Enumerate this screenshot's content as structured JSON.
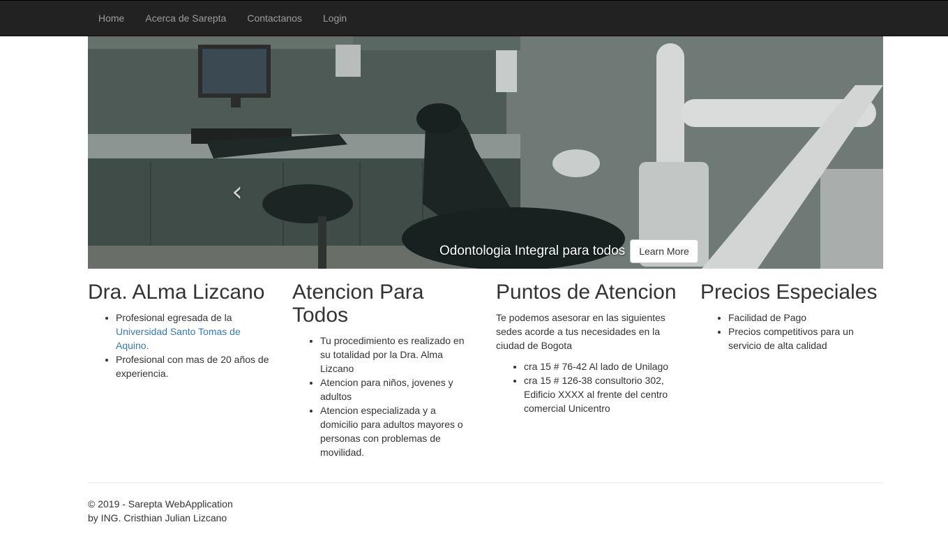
{
  "nav": {
    "items": [
      {
        "label": "Home"
      },
      {
        "label": "Acerca de Sarepta"
      },
      {
        "label": "Contactanos"
      },
      {
        "label": "Login"
      }
    ]
  },
  "carousel": {
    "caption": "Odontologia Integral para todos",
    "button_label": "Learn More",
    "prev_glyph": "‹",
    "next_glyph": "›",
    "slide_count": 3,
    "active_slide": 2
  },
  "columns": [
    {
      "heading": "Dra. ALma Lizcano",
      "items": [
        {
          "text": "Profesional egresada de la ",
          "link": "Universidad Santo Tomas de Aquino."
        },
        {
          "text": "Profesional con mas de 20 años de experiencia."
        }
      ]
    },
    {
      "heading": "Atencion Para Todos",
      "items": [
        {
          "text": "Tu procedimiento es realizado en su totalidad por la Dra. Alma Lizcano"
        },
        {
          "text": "Atencion para niños, jovenes y adultos"
        },
        {
          "text": "Atencion especializada y a domicilio para adultos mayores o personas con problemas de movilidad."
        }
      ]
    },
    {
      "heading": "Puntos de Atencion",
      "intro": "Te podemos asesorar en las siguientes sedes acorde a tus necesidades en la ciudad de Bogota",
      "items": [
        {
          "text": "cra 15 # 76-42 Al lado de Unilago"
        },
        {
          "text": "cra 15 # 126-38 consultorio 302, Edificio XXXX al frente del centro comercial Unicentro"
        }
      ]
    },
    {
      "heading": "Precios Especiales",
      "items": [
        {
          "text": "Facilidad de Pago"
        },
        {
          "text": "Precios competitivos para un servicio de alta calidad"
        }
      ]
    }
  ],
  "footer": {
    "line1": "© 2019 - Sarepta WebApplication",
    "line2": "by ING. Cristhian Julian Lizcano"
  },
  "colors": {
    "navbar_bg": "#222222",
    "nav_text": "#9d9d9d",
    "link": "#337ab7",
    "text": "#333333"
  }
}
